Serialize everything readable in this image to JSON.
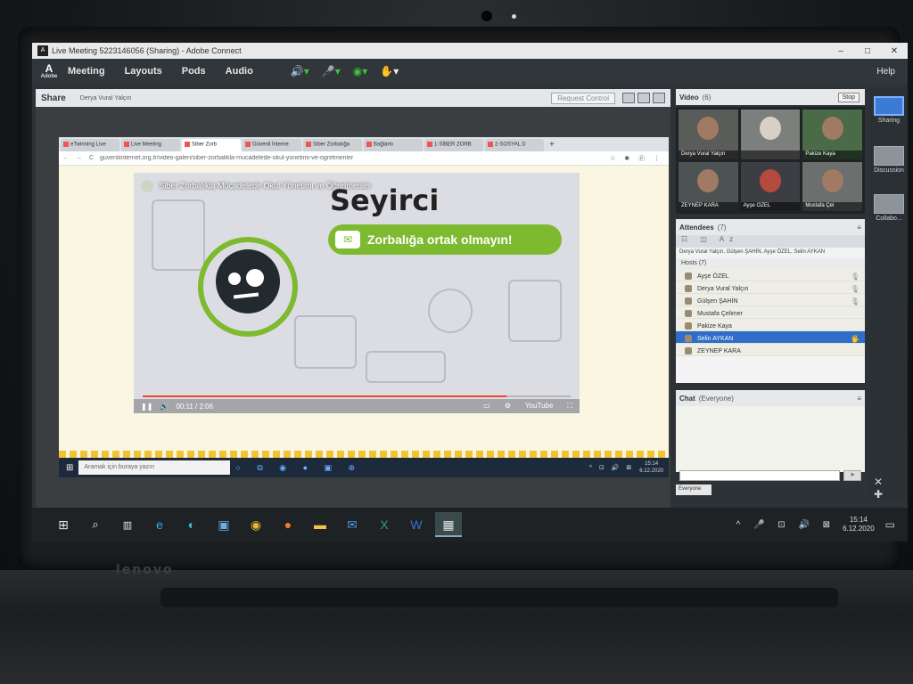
{
  "window": {
    "title": "Live Meeting 5223146056 (Sharing) - Adobe Connect",
    "controls": [
      "–",
      "□",
      "✕"
    ]
  },
  "menubar": {
    "logo_letter": "A",
    "logo_text": "Adobe",
    "items": [
      "Meeting",
      "Layouts",
      "Pods",
      "Audio"
    ],
    "help": "Help"
  },
  "share_pod": {
    "title": "Share",
    "presenter": "Derya Vural Yalçın",
    "request_control": "Request Control"
  },
  "browser": {
    "tabs": [
      {
        "label": "eTwinning Live"
      },
      {
        "label": "Live Meeting"
      },
      {
        "label": "Siber Zorb"
      },
      {
        "label": "Güvenli İnterne"
      },
      {
        "label": "Siber Zorbalığa"
      },
      {
        "label": "Bağlantı"
      },
      {
        "label": "1-SİBER ZORB"
      },
      {
        "label": "2-SOSYAL D"
      }
    ],
    "new_tab": "+",
    "nav_icons": "← → C",
    "url": "guvenliinternet.org.tr/video-galeri/siber-zorbalikla-mucadelede-okul-yonetimi-ve-ogretmenler",
    "ext_icons": "☆ ✱ ⓟ ⋮"
  },
  "video": {
    "channel_title": "Siber Zorbalıkla Mücadelede Okul Yönetimi ve Öğretmenler",
    "heading": "Seyirci",
    "pill_text": "Zorbalığa ortak olmayın!",
    "envelope_icon": "✉",
    "time": "00:11 / 2:06",
    "progress": 0.85,
    "play_icon": "❚❚",
    "right_controls": [
      "▭",
      "⚙",
      "YouTube",
      "⛶"
    ]
  },
  "inner_taskbar": {
    "win_icon": "⊞",
    "search_placeholder": "Aramak için buraya yazın",
    "icons": "○ ⧉ ◉ ● ▣ ⊕",
    "tray": "^ ⊡ 🔊 ⊠",
    "time": "15:14",
    "date": "6.12.2020"
  },
  "video_pod": {
    "title": "Video",
    "count": "(6)",
    "stop_label": "Stop",
    "participants": [
      {
        "name": "Derya Vural Yalçın"
      },
      {
        "name": ""
      },
      {
        "name": "Pakize Kaya"
      },
      {
        "name": "ZEYNEP KARA"
      },
      {
        "name": "Ayşe ÖZEL"
      },
      {
        "name": "Mustafa Çel"
      }
    ]
  },
  "attendees_pod": {
    "title": "Attendees",
    "count": "(7)",
    "tools": "☷ ◫ Az",
    "speaking": "Derya Vural Yalçın, Gülşen ŞAHİN, Ayşe ÖZEL, Selin AYKAN",
    "group": "Hosts (7)",
    "rows": [
      {
        "name": "Ayşe ÖZEL",
        "mic": "🎙"
      },
      {
        "name": "Derya Vural Yalçın",
        "mic": "🎙"
      },
      {
        "name": "Gülşen ŞAHİN",
        "mic": "🎙"
      },
      {
        "name": "Mustafa Çelimer",
        "mic": ""
      },
      {
        "name": "Pakize Kaya",
        "mic": ""
      },
      {
        "name": "Selin AYKAN",
        "mic": "🖐"
      },
      {
        "name": "ZEYNEP KARA",
        "mic": ""
      }
    ]
  },
  "chat_pod": {
    "title": "Chat",
    "scope": "(Everyone)",
    "tab": "Everyone",
    "send_icon": "➤"
  },
  "layouts_rail": {
    "items": [
      "Sharing",
      "Discussion",
      "Collabo..."
    ],
    "bottom_icons": "✕ ✚"
  },
  "taskbar": {
    "tray": "^ 🎤 ⊡ 🔊 ⊠",
    "time": "15:14",
    "date": "6.12.2020",
    "notif": "▭"
  },
  "device": {
    "brand": "lenovo"
  },
  "colors": {
    "accent_green": "#7dba2f",
    "selection_blue": "#2e6ec7",
    "connect_dark": "#30363a"
  }
}
